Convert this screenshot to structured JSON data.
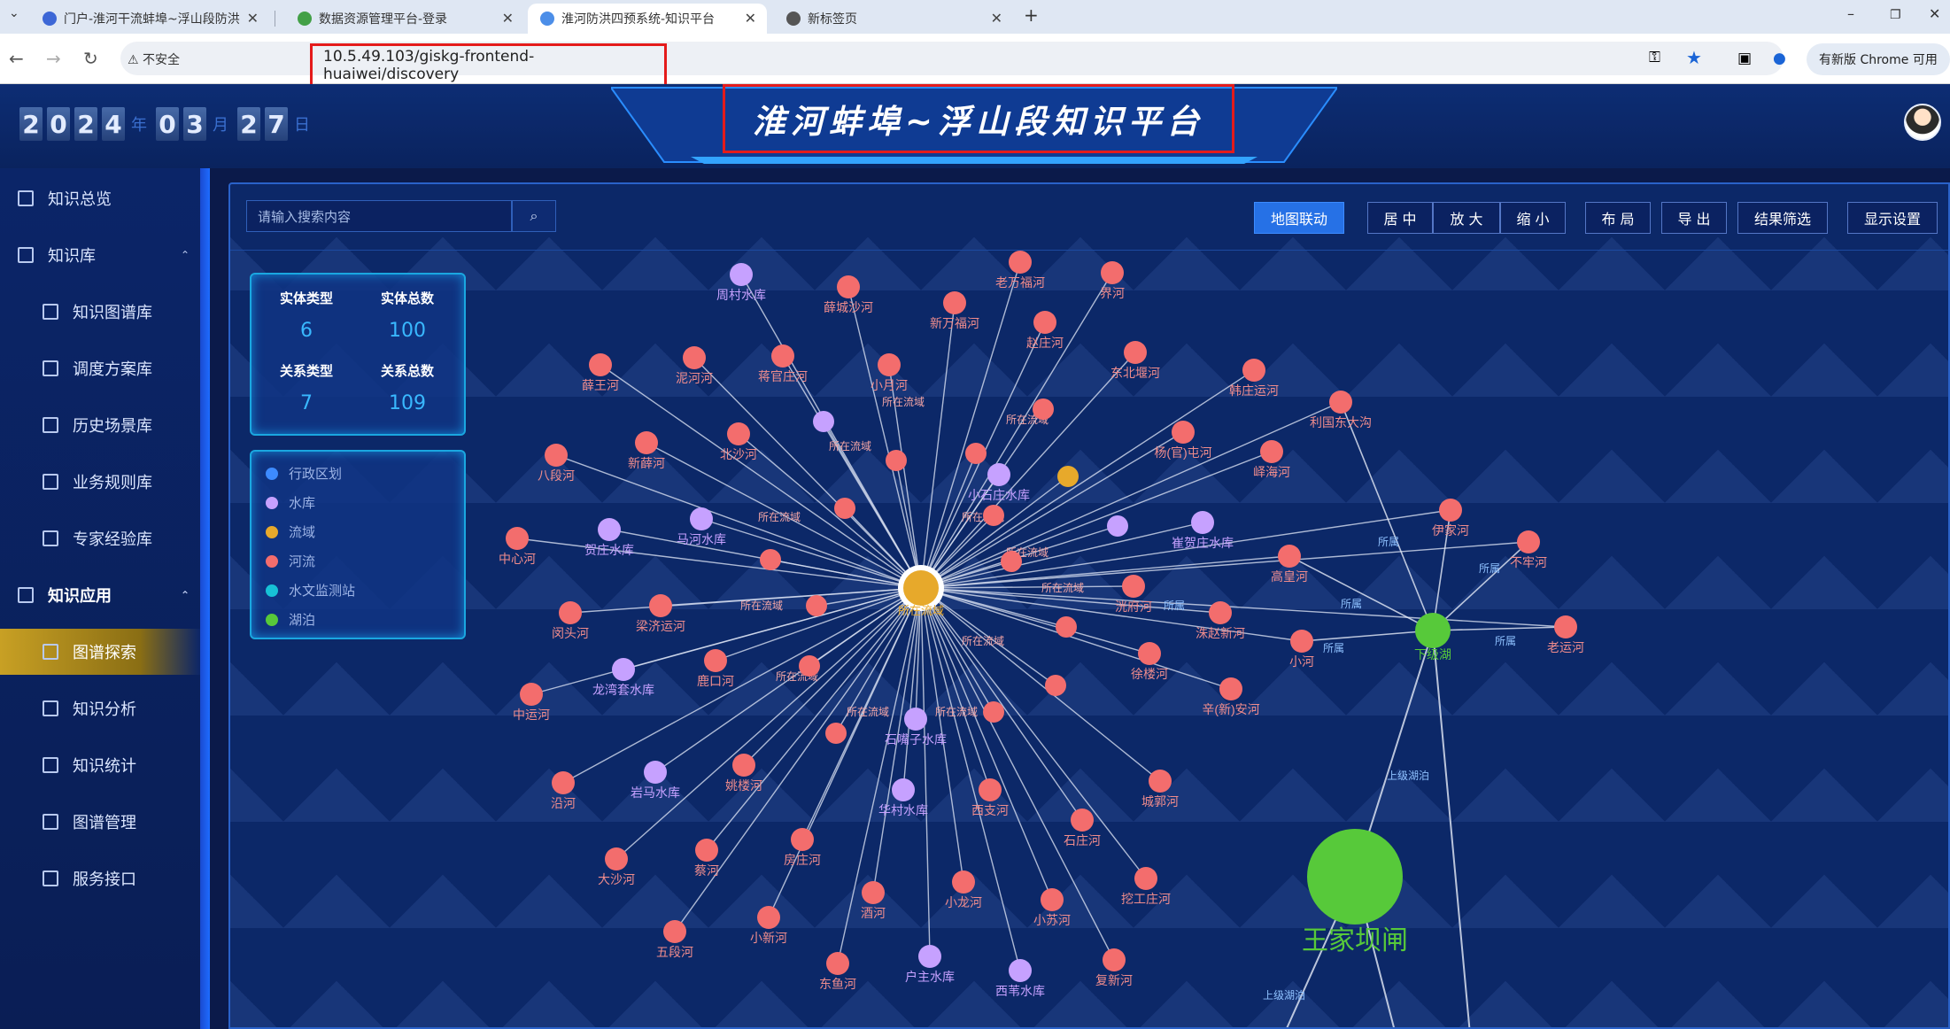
{
  "browser": {
    "tabs": [
      {
        "label": "门户-淮河干流蚌埠~浮山段防洪",
        "icon_color": "#3d67d6"
      },
      {
        "label": "数据资源管理平台-登录",
        "icon_color": "#43a047"
      },
      {
        "label": "淮河防洪四预系统-知识平台",
        "icon_color": "#4c8ee8"
      },
      {
        "label": "新标签页",
        "icon_color": "#555555"
      }
    ],
    "active_tab": 2,
    "insecure_label": "不安全",
    "url": "10.5.49.103/giskg-frontend-huaiwei/discovery",
    "update_label": "有新版 Chrome 可用"
  },
  "header": {
    "title": "淮河蚌埠~浮山段知识平台",
    "date_digits": {
      "year": "2024",
      "month": "03",
      "day": "27"
    },
    "date_units": {
      "year": "年",
      "month": "月",
      "day": "日"
    }
  },
  "sidebar": {
    "items": [
      {
        "label": "知识总览",
        "level": "top"
      },
      {
        "label": "知识库",
        "level": "top",
        "caret": "⌃"
      },
      {
        "label": "知识图谱库",
        "level": "sub"
      },
      {
        "label": "调度方案库",
        "level": "sub"
      },
      {
        "label": "历史场景库",
        "level": "sub"
      },
      {
        "label": "业务规则库",
        "level": "sub"
      },
      {
        "label": "专家经验库",
        "level": "sub"
      },
      {
        "label": "知识应用",
        "level": "top",
        "caret": "⌃"
      },
      {
        "label": "图谱探索",
        "level": "sub",
        "active": true
      },
      {
        "label": "知识分析",
        "level": "sub"
      },
      {
        "label": "知识统计",
        "level": "sub"
      },
      {
        "label": "图谱管理",
        "level": "sub"
      },
      {
        "label": "服务接口",
        "level": "sub"
      }
    ]
  },
  "toolbar": {
    "search_placeholder": "请输入搜索内容",
    "map_link": "地图联动",
    "center": "居 中",
    "zoom_in": "放 大",
    "zoom_out": "缩 小",
    "layout": "布 局",
    "export": "导 出",
    "filter": "结果筛选",
    "display": "显示设置"
  },
  "stats": {
    "entity_type_label": "实体类型",
    "entity_type_value": "6",
    "entity_total_label": "实体总数",
    "entity_total_value": "100",
    "relation_type_label": "关系类型",
    "relation_type_value": "7",
    "relation_total_label": "关系总数",
    "relation_total_value": "109"
  },
  "legend": [
    {
      "label": "行政区划",
      "color": "#3d8bff"
    },
    {
      "label": "水库",
      "color": "#c6a1ff"
    },
    {
      "label": "流域",
      "color": "#e7a92b"
    },
    {
      "label": "河流",
      "color": "#f36d6d"
    },
    {
      "label": "水文监测站",
      "color": "#17c1d6"
    },
    {
      "label": "湖泊",
      "color": "#57c93a"
    }
  ],
  "graph": {
    "hubs": [
      {
        "id": "hubA",
        "label": "所在流域",
        "type": "流域"
      },
      {
        "id": "lake",
        "label": "下级湖",
        "type": "湖泊"
      },
      {
        "id": "wjbz",
        "label": "王家坝闸",
        "type": "湖泊"
      }
    ],
    "nodes": [
      {
        "label": "周村水库",
        "type": "水库"
      },
      {
        "label": "薛城沙河",
        "type": "河流"
      },
      {
        "label": "老万福河",
        "type": "河流"
      },
      {
        "label": "界河",
        "type": "河流"
      },
      {
        "label": "新万福河",
        "type": "河流"
      },
      {
        "label": "赵庄河",
        "type": "河流"
      },
      {
        "label": "薛王河",
        "type": "河流"
      },
      {
        "label": "泥河河",
        "type": "河流"
      },
      {
        "label": "蒋官庄河",
        "type": "河流"
      },
      {
        "label": "小月河",
        "type": "河流"
      },
      {
        "label": "东北堰河",
        "type": "河流"
      },
      {
        "label": "韩庄运河",
        "type": "河流"
      },
      {
        "label": "利国东大沟",
        "type": "河流"
      },
      {
        "label": "八段河",
        "type": "河流"
      },
      {
        "label": "新薛河",
        "type": "河流"
      },
      {
        "label": "北沙河",
        "type": "河流"
      },
      {
        "label": "伊家河",
        "type": "河流"
      },
      {
        "label": "中心河",
        "type": "河流"
      },
      {
        "label": "贺庄水库",
        "type": "水库"
      },
      {
        "label": "马河水库",
        "type": "水库"
      },
      {
        "label": "小石庄水库",
        "type": "水库"
      },
      {
        "label": "杨(官)屯河",
        "type": "河流"
      },
      {
        "label": "峄海河",
        "type": "河流"
      },
      {
        "label": "崔贺庄水库",
        "type": "水库"
      },
      {
        "label": "高皇河",
        "type": "河流"
      },
      {
        "label": "不牢河",
        "type": "河流"
      },
      {
        "label": "闵头河",
        "type": "河流"
      },
      {
        "label": "梁济运河",
        "type": "河流"
      },
      {
        "label": "洸府河",
        "type": "河流"
      },
      {
        "label": "洙赵新河",
        "type": "河流"
      },
      {
        "label": "小河",
        "type": "河流"
      },
      {
        "label": "老运河",
        "type": "河流"
      },
      {
        "label": "中运河",
        "type": "河流"
      },
      {
        "label": "龙湾套水库",
        "type": "水库"
      },
      {
        "label": "鹿口河",
        "type": "河流"
      },
      {
        "label": "徐楼河",
        "type": "河流"
      },
      {
        "label": "辛(新)安河",
        "type": "河流"
      },
      {
        "label": "石嘴子水库",
        "type": "水库"
      },
      {
        "label": "沿河",
        "type": "河流"
      },
      {
        "label": "岩马水库",
        "type": "水库"
      },
      {
        "label": "姚楼河",
        "type": "河流"
      },
      {
        "label": "城郭河",
        "type": "河流"
      },
      {
        "label": "西支河",
        "type": "河流"
      },
      {
        "label": "华村水库",
        "type": "水库"
      },
      {
        "label": "房庄河",
        "type": "河流"
      },
      {
        "label": "大沙河",
        "type": "河流"
      },
      {
        "label": "蔡河",
        "type": "河流"
      },
      {
        "label": "石庄河",
        "type": "河流"
      },
      {
        "label": "酒河",
        "type": "河流"
      },
      {
        "label": "小龙河",
        "type": "河流"
      },
      {
        "label": "小苏河",
        "type": "河流"
      },
      {
        "label": "挖工庄河",
        "type": "河流"
      },
      {
        "label": "五段河",
        "type": "河流"
      },
      {
        "label": "小新河",
        "type": "河流"
      },
      {
        "label": "户主水库",
        "type": "水库"
      },
      {
        "label": "东鱼河",
        "type": "河流"
      },
      {
        "label": "西苇水库",
        "type": "水库"
      },
      {
        "label": "复新河",
        "type": "河流"
      }
    ],
    "edge_labels": {
      "basin": "所在流域",
      "belongs": "所属",
      "upstream": "上级湖泊"
    }
  }
}
